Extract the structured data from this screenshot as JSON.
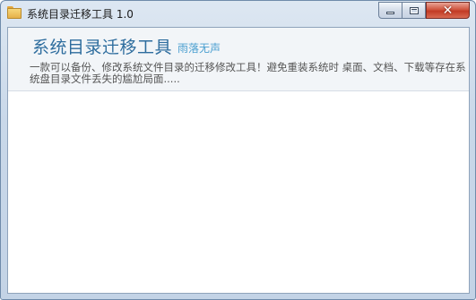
{
  "window": {
    "title": "系统目录迁移工具 1.0"
  },
  "header": {
    "app_title": "系统目录迁移工具",
    "author": "雨落无声",
    "description": "一款可以备份、修改系统文件目录的迁移修改工具！避免重装系统时 桌面、文档、下载等存在系统盘目录文件丢失的尴尬局面....."
  },
  "icons": {
    "app": "folder-icon",
    "minimize": "minimize-icon",
    "maximize": "maximize-icon",
    "close": "close-icon"
  },
  "colors": {
    "title_accent": "#2e6d9e",
    "author_accent": "#4a9fd0",
    "close_button": "#c23a24"
  }
}
